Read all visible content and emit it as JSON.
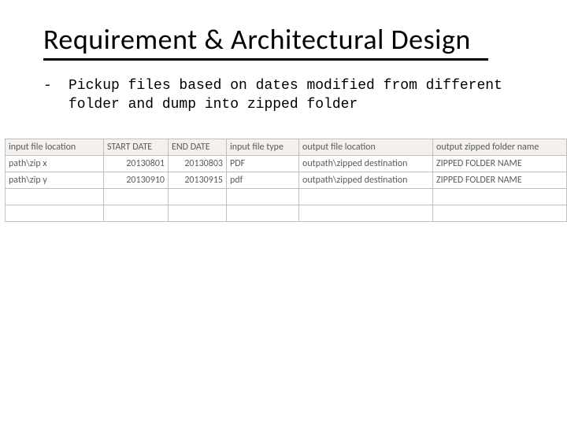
{
  "title": "Requirement & Architectural Design",
  "bullet": {
    "marker": "-",
    "text": "Pickup files based on dates modified from different folder and dump into zipped folder"
  },
  "table": {
    "headers": [
      "input file location",
      "START DATE",
      "END DATE",
      "input file type",
      "output file location",
      "output zipped folder name"
    ],
    "rows": [
      [
        "path\\zip x",
        "20130801",
        "20130803",
        "PDF",
        "outpath\\zipped destination",
        "ZIPPED FOLDER NAME"
      ],
      [
        "path\\zip y",
        "20130910",
        "20130915",
        "pdf",
        "outpath\\zipped destination",
        "ZIPPED FOLDER NAME"
      ],
      [
        "",
        "",
        "",
        "",
        "",
        ""
      ],
      [
        "",
        "",
        "",
        "",
        "",
        ""
      ]
    ]
  }
}
